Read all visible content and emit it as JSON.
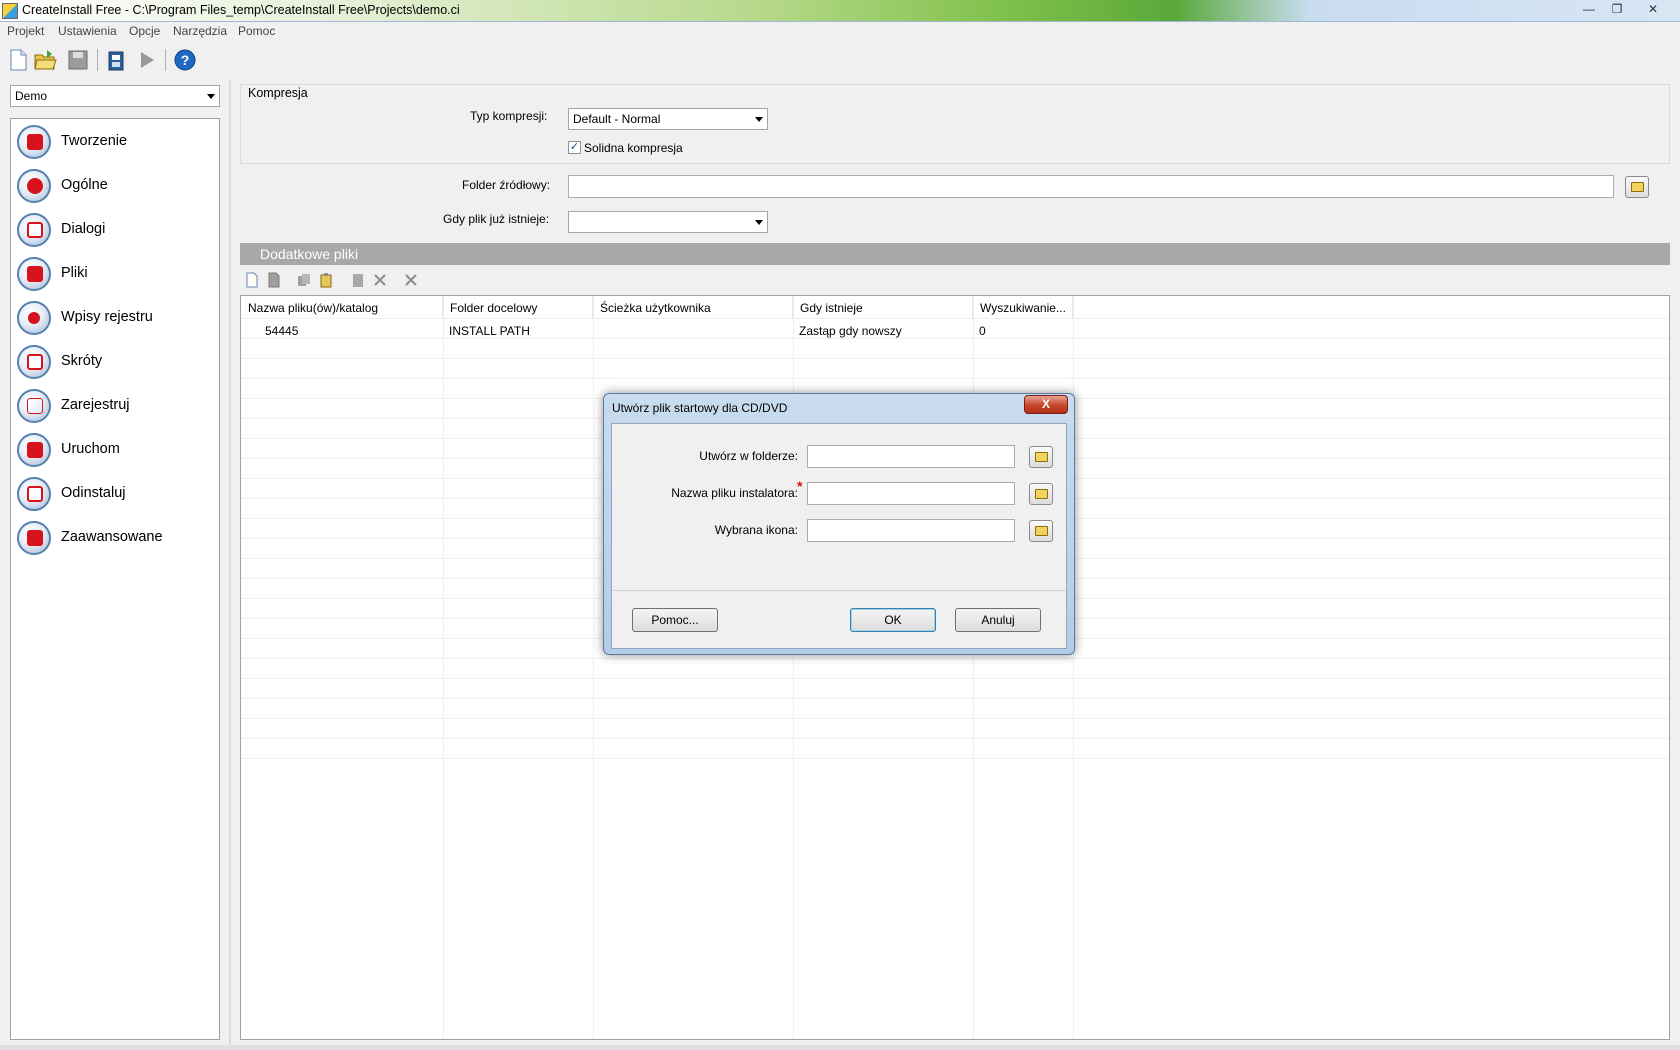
{
  "window": {
    "title": "CreateInstall Free - C:\\Program Files_temp\\CreateInstall Free\\Projects\\demo.ci",
    "minimize": "—",
    "restore": "❐",
    "close": "✕"
  },
  "menu": [
    "Projekt",
    "Ustawienia",
    "Opcje",
    "Narzędzia",
    "Pomoc"
  ],
  "toolbar": {
    "icons": [
      "new-file-icon",
      "open-folder-icon",
      "save-icon",
      "build-icon",
      "run-icon",
      "help-icon"
    ]
  },
  "project_combo": {
    "value": "Demo"
  },
  "nav": [
    {
      "label": "Tworzenie",
      "icon": "build-disk-icon"
    },
    {
      "label": "Ogólne",
      "icon": "shapes-icon"
    },
    {
      "label": "Dialogi",
      "icon": "dialog-icon"
    },
    {
      "label": "Pliki",
      "icon": "folder-icon"
    },
    {
      "label": "Wpisy rejestru",
      "icon": "registry-icon"
    },
    {
      "label": "Skróty",
      "icon": "shortcut-icon"
    },
    {
      "label": "Zarejestruj",
      "icon": "register-com-font-icon"
    },
    {
      "label": "Uruchom",
      "icon": "run-icon"
    },
    {
      "label": "Odinstaluj",
      "icon": "uninstall-icon"
    },
    {
      "label": "Zaawansowane",
      "icon": "advanced-icon"
    }
  ],
  "compression": {
    "group_title": "Kompresja",
    "type_label": "Typ kompresji:",
    "type_value": "Default - Normal",
    "solid_label": "Solidna kompresja",
    "solid_checked": true
  },
  "source": {
    "folder_label": "Folder źródłowy:",
    "folder_value": "",
    "exists_label": "Gdy plik już istnieje:",
    "exists_value": ""
  },
  "extra_files": {
    "header": "Dodatkowe pliki",
    "columns": [
      "Nazwa pliku(ów)/katalog",
      "Folder docelowy",
      "Ścieżka użytkownika",
      "Gdy istnieje",
      "Wyszukiwanie..."
    ],
    "rows": [
      [
        "54445",
        "INSTALL PATH",
        "",
        "Zastąp gdy nowszy",
        "0"
      ]
    ]
  },
  "dialog": {
    "title": "Utwórz plik startowy dla CD/DVD",
    "close": "X",
    "fields": [
      {
        "label": "Utwórz w folderze:",
        "value": "",
        "required": false
      },
      {
        "label": "Nazwa pliku instalatora:",
        "value": "",
        "required": true
      },
      {
        "label": "Wybrana ikona:",
        "value": "",
        "required": false
      }
    ],
    "required_mark": "*",
    "help_button": "Pomoc...",
    "ok_button": "OK",
    "cancel_button": "Anuluj"
  }
}
